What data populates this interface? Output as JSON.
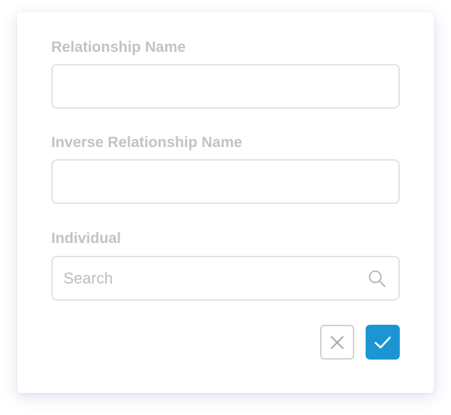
{
  "form": {
    "relationship_name": {
      "label": "Relationship Name",
      "value": "",
      "placeholder": ""
    },
    "inverse_relationship_name": {
      "label": "Inverse Relationship Name",
      "value": "",
      "placeholder": ""
    },
    "individual": {
      "label": "Individual",
      "value": "",
      "placeholder": "Search",
      "icon": "search-icon"
    }
  },
  "actions": {
    "cancel_icon": "close-icon",
    "confirm_icon": "checkmark-icon"
  },
  "colors": {
    "label": "#c3c3c3",
    "input_border": "#e2e2e2",
    "placeholder": "#bdbdbd",
    "confirm_background": "#1c96d2",
    "cancel_border": "#d2d2d2"
  }
}
